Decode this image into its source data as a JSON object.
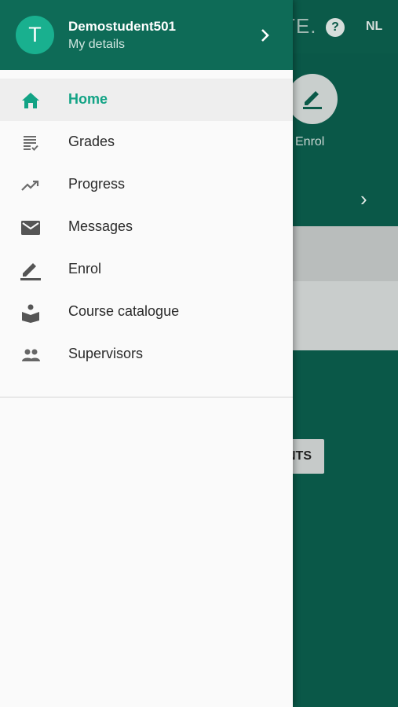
{
  "background": {
    "logo_text": "TE.",
    "help_label": "?",
    "language": "NL",
    "enrol_label": "Enrol",
    "button_label": "NTS"
  },
  "drawer": {
    "avatar_letter": "T",
    "user_name": "Demostudent501",
    "user_subtitle": "My details",
    "items": [
      {
        "label": "Home",
        "icon": "home-icon",
        "active": true
      },
      {
        "label": "Grades",
        "icon": "grades-icon",
        "active": false
      },
      {
        "label": "Progress",
        "icon": "trending-up-icon",
        "active": false
      },
      {
        "label": "Messages",
        "icon": "mail-icon",
        "active": false
      },
      {
        "label": "Enrol",
        "icon": "pen-icon",
        "active": false
      },
      {
        "label": "Course catalogue",
        "icon": "book-reader-icon",
        "active": false
      },
      {
        "label": "Supervisors",
        "icon": "people-icon",
        "active": false
      }
    ]
  },
  "colors": {
    "header_green": "#0e6b57",
    "accent": "#12a385",
    "avatar": "#19b08f"
  }
}
